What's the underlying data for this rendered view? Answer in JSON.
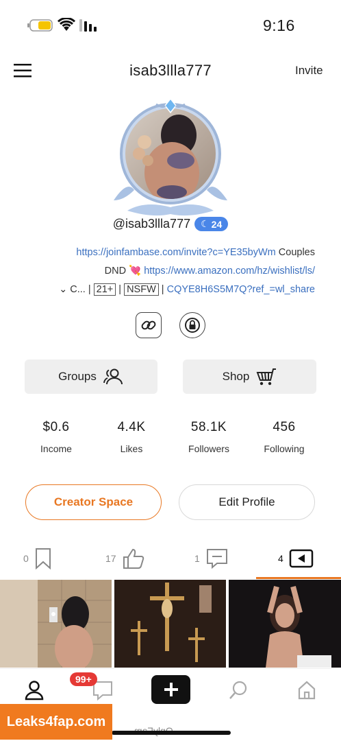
{
  "status_bar": {
    "time": "9:16"
  },
  "header": {
    "username": "isab3llla777",
    "invite_label": "Invite"
  },
  "profile": {
    "handle": "@isab3llla777",
    "level": "24",
    "bio": {
      "line1_link": "https://joinfambase.com/invite?c=YE35byWm",
      "line1_text": " Couples",
      "line2_text": "DND 💘 ",
      "line2_link": "https://www.amazon.com/hz/wishlist/ls/",
      "line3_link": "CQYE8H6S5M7Q?ref_=wl_share",
      "line3_tag1": "NSFW",
      "line3_tag2": "21+",
      "line3_more": "C..."
    }
  },
  "buttons": {
    "shop_label": "Shop",
    "groups_label": "Groups",
    "edit_profile_label": "Edit Profile",
    "creator_space_label": "Creator Space"
  },
  "stats": [
    {
      "value": "456",
      "label": "Following"
    },
    {
      "value": "58.1K",
      "label": "Followers"
    },
    {
      "value": "4.4K",
      "label": "Likes"
    },
    {
      "value": "$0.6",
      "label": "Income"
    }
  ],
  "tabs": {
    "posts_count": "4",
    "comments_count": "1",
    "likes_count": "17",
    "saved_count": "0"
  },
  "bottom_nav": {
    "messages_badge": "99+",
    "footer_text": "OnlyFam"
  },
  "watermark": "Leaks4fap.com",
  "colors": {
    "accent": "#e87722",
    "link": "#3a6fbf",
    "badge": "#e53935",
    "level_badge": "#4a86e8"
  }
}
